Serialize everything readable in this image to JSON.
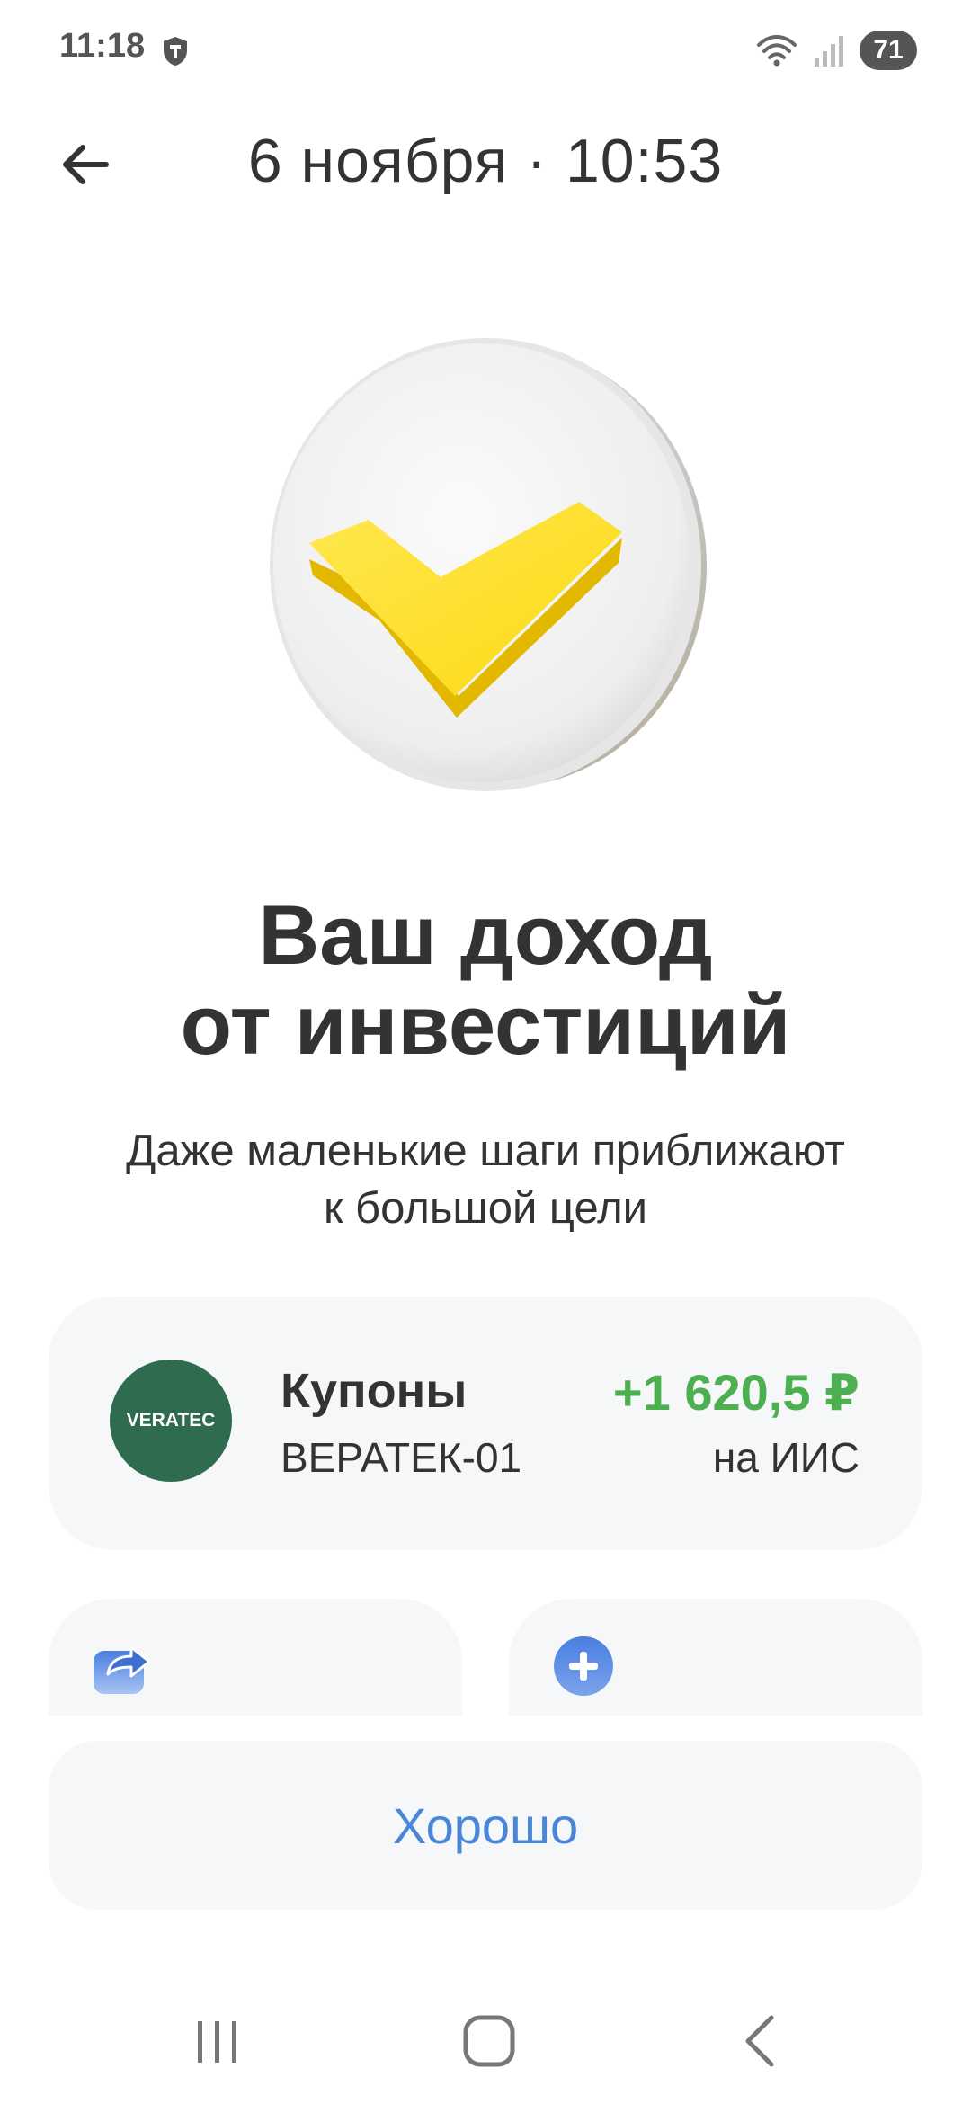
{
  "status_bar": {
    "time": "11:18",
    "battery": "71"
  },
  "header": {
    "title": "6 ноября · 10:53"
  },
  "hero": {
    "icon": "yellow-checkmark-coin"
  },
  "headline": {
    "line1": "Ваш доход",
    "line2": "от инвестиций"
  },
  "subtitle": {
    "line1": "Даже маленькие шаги приближают",
    "line2": "к большой цели"
  },
  "income": {
    "logo_text": "VERATEC",
    "title": "Купоны",
    "ticker": "ВЕРАТЕК-01",
    "amount": "+1 620,5 ₽",
    "account": "на ИИС"
  },
  "actions": {
    "share_icon": "share-arrow-icon",
    "add_icon": "plus-circle-icon"
  },
  "ok_button": {
    "label": "Хорошо"
  },
  "colors": {
    "accent_green": "#4caf50",
    "accent_blue": "#4a86d8",
    "logo_green": "#2e6b4f",
    "card_bg": "#f6f7f8"
  }
}
